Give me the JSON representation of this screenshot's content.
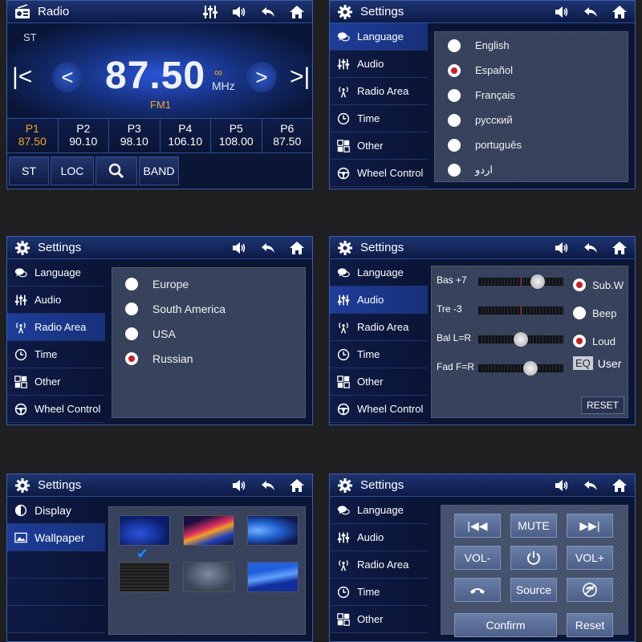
{
  "radio": {
    "title": "Radio",
    "stereo": "ST",
    "frequency": "87.50",
    "unit": "MHz",
    "band": "FM1",
    "stereo_symbol": "∞",
    "presets": [
      {
        "name": "P1",
        "freq": "87.50",
        "active": true
      },
      {
        "name": "P2",
        "freq": "90.10"
      },
      {
        "name": "P3",
        "freq": "98.10"
      },
      {
        "name": "P4",
        "freq": "106.10"
      },
      {
        "name": "P5",
        "freq": "108.00"
      },
      {
        "name": "P6",
        "freq": "87.50"
      }
    ],
    "buttons": {
      "st": "ST",
      "loc": "LOC",
      "band": "BAND"
    }
  },
  "settings_title": "Settings",
  "sidebar": {
    "language": "Language",
    "audio": "Audio",
    "radio_area": "Radio Area",
    "time": "Time",
    "other": "Other",
    "wheel_control": "Wheel Control",
    "display": "Display",
    "wallpaper": "Wallpaper"
  },
  "languages": [
    "English",
    "Español",
    "Français",
    "русский",
    "português",
    "اردو"
  ],
  "language_selected": 1,
  "regions": [
    "Europe",
    "South America",
    "USA",
    "Russian"
  ],
  "region_selected": 3,
  "audio": {
    "bass": "Bas +7",
    "treble": "Tre -3",
    "balance": "Bal L=R",
    "fader": "Fad F=R",
    "subw": "Sub.W",
    "beep": "Beep",
    "loud": "Loud",
    "eq": "EQ",
    "eq_value": "User",
    "reset": "RESET",
    "bass_level": 0.7,
    "balance_level": 0.5,
    "fader_level": 0.62
  },
  "wheel": {
    "mute": "MUTE",
    "vol_down": "VOL-",
    "vol_up": "VOL+",
    "source": "Source",
    "confirm": "Confirm",
    "reset": "Reset"
  },
  "colors": {
    "accent": "#f5a623",
    "selected_dot": "#d01c1c",
    "panel_border": "#3a5fa8"
  },
  "icons": [
    "radio-icon",
    "equalizer-icon",
    "volume-icon",
    "back-icon",
    "home-icon",
    "gear-icon",
    "chat-icon",
    "antenna-icon",
    "clock-icon",
    "grid-icon",
    "steering-wheel-icon",
    "display-icon",
    "wallpaper-icon",
    "search-icon",
    "check-icon",
    "prev-track-icon",
    "next-track-icon",
    "power-icon",
    "hang-up-icon",
    "phone-icon"
  ]
}
